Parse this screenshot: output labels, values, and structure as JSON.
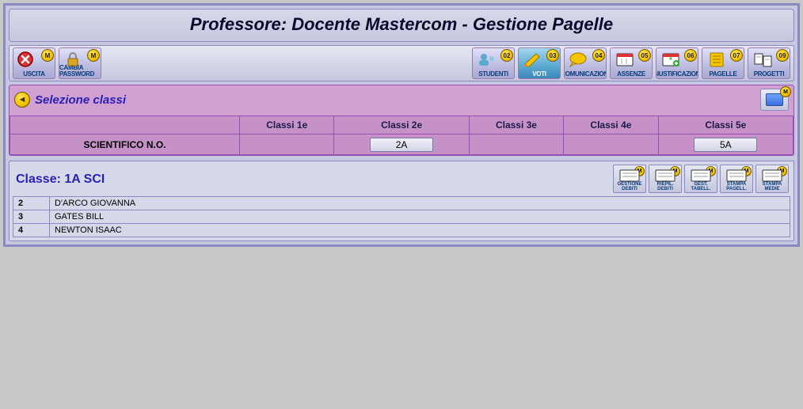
{
  "title": "Professore: Docente Mastercom - Gestione Pagelle",
  "toolbar": {
    "left": [
      {
        "name": "uscita-button",
        "label": "USCITA",
        "badge": "M",
        "icon": "exit"
      },
      {
        "name": "cambia-password-button",
        "label": "CAMBIA PASSWORD",
        "badge": "M",
        "icon": "lock"
      }
    ],
    "right": [
      {
        "name": "studenti-button",
        "label": "STUDENTI",
        "badge": "02",
        "icon": "student"
      },
      {
        "name": "voti-button",
        "label": "VOTI",
        "badge": "03",
        "icon": "pencil",
        "selected": true
      },
      {
        "name": "comunicazioni-button",
        "label": "COMUNICAZIONI",
        "badge": "04",
        "icon": "speech"
      },
      {
        "name": "assenze-button",
        "label": "ASSENZE",
        "badge": "05",
        "icon": "calendar"
      },
      {
        "name": "giustificazioni-button",
        "label": "GIUSTIFICAZIONI",
        "badge": "06",
        "icon": "calendar-plus"
      },
      {
        "name": "pagelle-button",
        "label": "PAGELLE",
        "badge": "07",
        "icon": "report"
      },
      {
        "name": "progetti-button",
        "label": "PROGETTI",
        "badge": "09",
        "icon": "projects"
      }
    ]
  },
  "section": {
    "title": "Selezione classi",
    "collapse_badge": "M",
    "row_label": "SCIENTIFICO N.O.",
    "columns": [
      "Classi 1e",
      "Classi 2e",
      "Classi 3e",
      "Classi 4e",
      "Classi 5e"
    ],
    "cells": [
      "",
      "2A",
      "",
      "",
      "5A"
    ]
  },
  "class_panel": {
    "title": "Classe: 1A SCI",
    "actions": [
      {
        "name": "gestione-debiti-button",
        "label": "GESTIONE DEBITI",
        "badge": "M"
      },
      {
        "name": "riepil-debiti-button",
        "label": "RIEPIL. DEBITI",
        "badge": "M"
      },
      {
        "name": "gest-tabell-button",
        "label": "GEST. TABELL.",
        "badge": "M"
      },
      {
        "name": "stampa-pagell-button",
        "label": "STAMPA PAGELL.",
        "badge": "M"
      },
      {
        "name": "stampa-medie-button",
        "label": "STAMPA MEDIE",
        "badge": "M"
      }
    ],
    "students": [
      {
        "n": "2",
        "name": "D'ARCO GIOVANNA"
      },
      {
        "n": "3",
        "name": "GATES BILL"
      },
      {
        "n": "4",
        "name": "NEWTON ISAAC"
      }
    ]
  }
}
